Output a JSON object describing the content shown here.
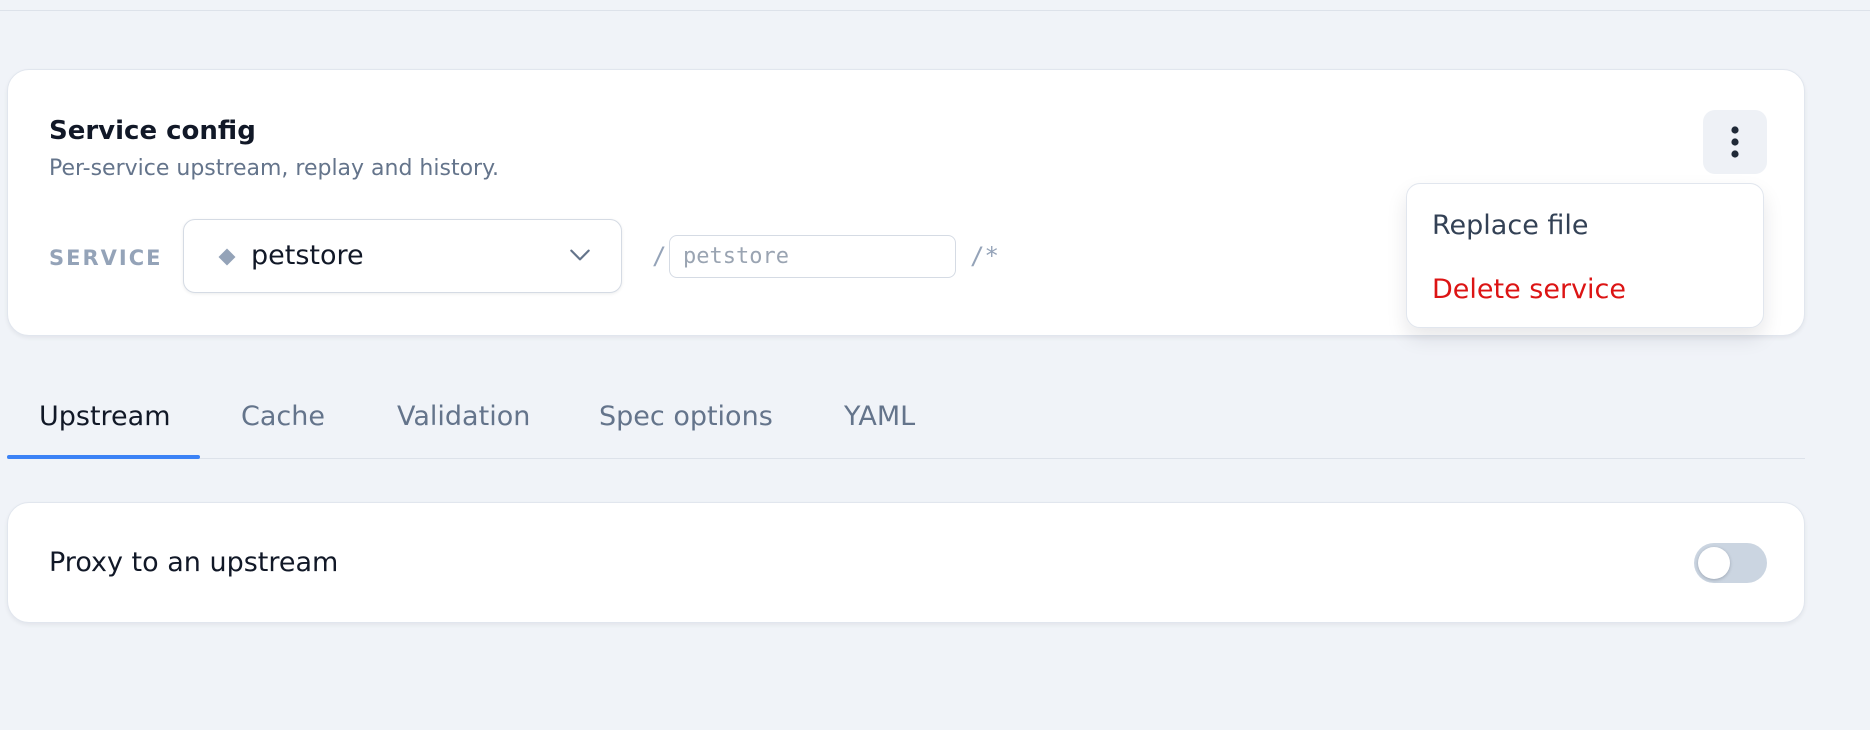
{
  "config": {
    "title": "Service config",
    "subtitle": "Per-service upstream, replay and history.",
    "service_label": "SERVICE",
    "service_select": {
      "icon": "diamond-icon",
      "selected": "petstore",
      "chevron_icon": "chevron-down-icon"
    },
    "path": {
      "slash": "/",
      "value": "",
      "placeholder": "petstore",
      "suffix": "/*"
    },
    "menu_button_icon": "kebab-icon",
    "menu": {
      "replace_file": "Replace file",
      "delete_service": "Delete service"
    }
  },
  "tabs": {
    "active": "Upstream",
    "items": [
      "Upstream",
      "Cache",
      "Validation",
      "Spec options",
      "YAML"
    ]
  },
  "proxy": {
    "label": "Proxy to an upstream",
    "enabled": false
  },
  "colors": {
    "accent": "#3b82f6",
    "danger": "#dc1414",
    "background": "#f0f3f8",
    "muted_text": "#64748b"
  }
}
